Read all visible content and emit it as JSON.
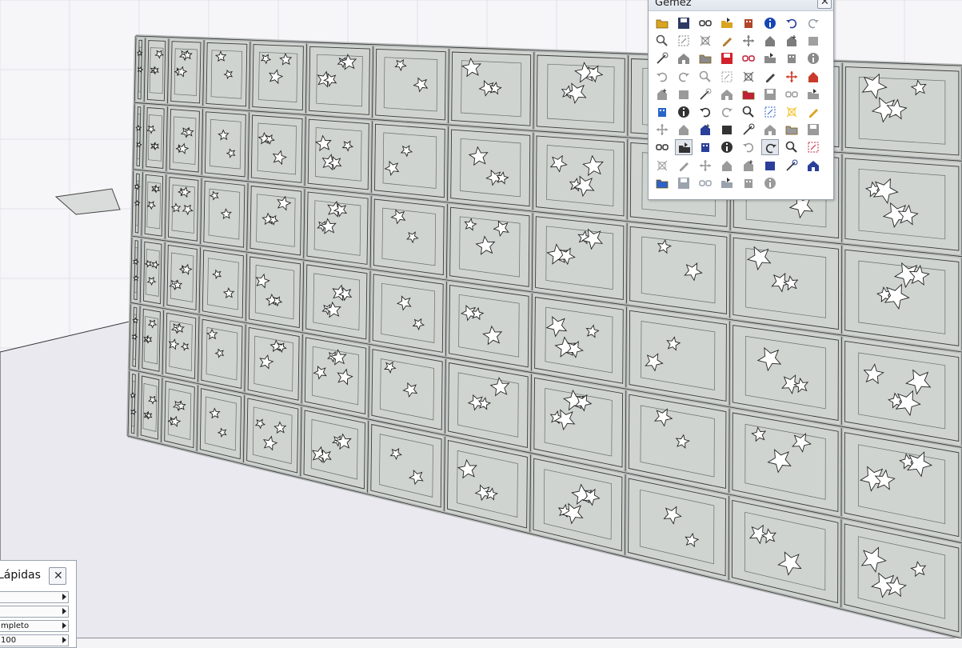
{
  "palette": {
    "title": "Gemez",
    "close_icon": "close-icon",
    "tools": [
      {
        "icon": "folder-open-icon",
        "color": "#d9a520"
      },
      {
        "icon": "save-disk-icon",
        "color": "#2d3b63"
      },
      {
        "icon": "link-chain-icon",
        "color": "#333333"
      },
      {
        "icon": "import-folder-icon",
        "color": "#d9a520"
      },
      {
        "icon": "building-export-icon",
        "color": "#b0462a"
      },
      {
        "icon": "info-icon",
        "color": "#1646b5"
      },
      {
        "icon": "undo-icon",
        "color": "#2a3f9a"
      },
      {
        "icon": "redo-icon",
        "color": "#9aa2ad"
      },
      {
        "icon": "find-object-icon",
        "color": "#555555"
      },
      {
        "icon": "component-select-icon",
        "color": "#7c7c7c"
      },
      {
        "icon": "component-align-icon",
        "color": "#7c7c7c"
      },
      {
        "icon": "pen-edit-icon",
        "color": "#b07b30"
      },
      {
        "icon": "move-arrows-icon",
        "color": "#7c7c7c"
      },
      {
        "icon": "house-arrow-icon",
        "color": "#7c7c7c"
      },
      {
        "icon": "building-arrow-icon",
        "color": "#7c7c7c"
      },
      {
        "icon": "component-gray-icon",
        "color": "#a0a0a0"
      },
      {
        "icon": "magic-wand-icon",
        "color": "#555555"
      },
      {
        "icon": "house-icon",
        "color": "#8a8a8a"
      },
      {
        "icon": "house-plus-icon",
        "color": "#8a8a8a"
      },
      {
        "icon": "house-red-icon",
        "color": "#d1212a"
      },
      {
        "icon": "floorplan-icon",
        "color": "#c21f38"
      },
      {
        "icon": "wall-icon",
        "color": "#8a8a8a"
      },
      {
        "icon": "explode-icon",
        "color": "#8a8a8a"
      },
      {
        "icon": "landscape-image-icon",
        "color": "#8a8a8a"
      },
      {
        "icon": "terrain-icon",
        "color": "#9a9a9a"
      },
      {
        "icon": "hatch-icon",
        "color": "#9a9a9a"
      },
      {
        "icon": "stairs-icon",
        "color": "#9a9a9a"
      },
      {
        "icon": "door-icon",
        "color": "#9a9a9a"
      },
      {
        "icon": "layers-icon",
        "color": "#555555"
      },
      {
        "icon": "layers-stack-icon",
        "color": "#444444"
      },
      {
        "icon": "paint-palette-icon",
        "color": "#d03a2a"
      },
      {
        "icon": "materials-icon",
        "color": "#c93a2a"
      },
      {
        "icon": "section-cut-icon",
        "color": "#9a9a9a"
      },
      {
        "icon": "section-box-icon",
        "color": "#9a9a9a"
      },
      {
        "icon": "section-plane-icon",
        "color": "#9a9a9a"
      },
      {
        "icon": "section-fill-icon",
        "color": "#9a9a9a"
      },
      {
        "icon": "dot-red-icon",
        "color": "#c21f38"
      },
      {
        "icon": "section-display-icon",
        "color": "#9a9a9a"
      },
      {
        "icon": "section-toggle-icon",
        "color": "#9a9a9a"
      },
      {
        "icon": "scene-icon",
        "color": "#9a9a9a"
      },
      {
        "icon": "paint-bucket-icon",
        "color": "#2a64c8"
      },
      {
        "icon": "monitor-image-icon",
        "color": "#333333"
      },
      {
        "icon": "camera-icon",
        "color": "#333333"
      },
      {
        "icon": "camera-gray-icon",
        "color": "#9a9a9a"
      },
      {
        "icon": "eyedropper-icon",
        "color": "#333333"
      },
      {
        "icon": "eyedropper-blue-icon",
        "color": "#2a64c8"
      },
      {
        "icon": "star-icon",
        "color": "#f0c020"
      },
      {
        "icon": "window-layers-icon",
        "color": "#d9a520"
      },
      {
        "icon": "rotate-object-icon",
        "color": "#9a9a9a"
      },
      {
        "icon": "rotate-plane-icon",
        "color": "#9a9a9a"
      },
      {
        "icon": "fold-icon",
        "color": "#2a3f9a"
      },
      {
        "icon": "pushpull-icon",
        "color": "#333333"
      },
      {
        "icon": "offset-icon",
        "color": "#333333"
      },
      {
        "icon": "line-pencil-icon",
        "color": "#9a9a9a"
      },
      {
        "icon": "sparkle-pencil-icon",
        "color": "#9a9a9a"
      },
      {
        "icon": "tape-icon",
        "color": "#9a9a9a"
      },
      {
        "icon": "dimension-icon",
        "color": "#333333"
      },
      {
        "icon": "text-label-icon",
        "color": "#333333",
        "pressed": true
      },
      {
        "icon": "grid-panels-icon",
        "color": "#2a3f9a"
      },
      {
        "icon": "pan-hand-icon",
        "color": "#333333"
      },
      {
        "icon": "view-box-icon",
        "color": "#9a9a9a"
      },
      {
        "icon": "freehand-line-icon",
        "color": "#333333",
        "pressed": true
      },
      {
        "icon": "scale-lines-icon",
        "color": "#333333"
      },
      {
        "icon": "delete-x-icon",
        "color": "#c21f38"
      },
      {
        "icon": "extrude-icon",
        "color": "#9a9a9a"
      },
      {
        "icon": "move-cross-icon",
        "color": "#9a9a9a"
      },
      {
        "icon": "copy-box-icon",
        "color": "#9a9a9a"
      },
      {
        "icon": "corner-icon",
        "color": "#9a9a9a"
      },
      {
        "icon": "push-arrow-icon",
        "color": "#9a9a9a"
      },
      {
        "icon": "zoom-icon",
        "color": "#2a3f9a"
      },
      {
        "icon": "zoom-window-icon",
        "color": "#2a3f9a"
      },
      {
        "icon": "zoom-extents-icon",
        "color": "#2a3f9a"
      },
      {
        "icon": "axes-icon",
        "color": "#2a64c8"
      },
      {
        "icon": "shadow-grid-icon",
        "color": "#9aa2ad"
      },
      {
        "icon": "fog-grid-icon",
        "color": "#9aa2ad"
      },
      {
        "icon": "grid-view-icon",
        "color": "#9aa2ad"
      },
      {
        "icon": "figure-icon",
        "color": "#9a9a9a"
      },
      {
        "icon": "vehicle-icon",
        "color": "#9a9a9a"
      }
    ]
  },
  "panel": {
    "title": "Lápidas",
    "close_icon": "close-icon",
    "rows": [
      "",
      "",
      "mpleto",
      "100"
    ]
  },
  "scene": {
    "panel_color": "#cfd4d0",
    "frame_color": "#b8bcbb",
    "ground_color": "#ebe9f0",
    "sky_color": "#f6f5f8"
  }
}
